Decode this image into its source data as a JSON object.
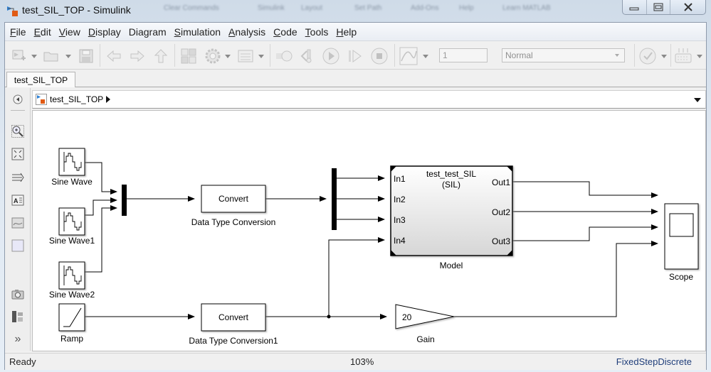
{
  "window": {
    "title": "test_SIL_TOP - Simulink",
    "background_blurred_items": [
      "Clear Commands",
      "Simulink",
      "Layout",
      "Set Path",
      "Add-Ons",
      "Help",
      "Learn MATLAB"
    ],
    "controls": {
      "minimize": "minimize",
      "maximize": "maximize",
      "close": "close"
    }
  },
  "menu": {
    "items": [
      {
        "label": "File",
        "mnemonic": "F",
        "rest": "ile"
      },
      {
        "label": "Edit",
        "mnemonic": "E",
        "rest": "dit"
      },
      {
        "label": "View",
        "mnemonic": "V",
        "rest": "iew"
      },
      {
        "label": "Display",
        "mnemonic": "D",
        "rest": "isplay"
      },
      {
        "label": "Diagram",
        "mnemonic": "",
        "rest": "Diagram"
      },
      {
        "label": "Simulation",
        "mnemonic": "S",
        "rest": "imulation"
      },
      {
        "label": "Analysis",
        "mnemonic": "A",
        "rest": "nalysis"
      },
      {
        "label": "Code",
        "mnemonic": "C",
        "rest": "ode"
      },
      {
        "label": "Tools",
        "mnemonic": "T",
        "rest": "ools"
      },
      {
        "label": "Help",
        "mnemonic": "H",
        "rest": "elp"
      }
    ]
  },
  "toolbar": {
    "stop_time": "1",
    "sim_mode": "Normal",
    "icons": [
      "new-model-icon",
      "open-folder-icon",
      "save-icon",
      "back-icon",
      "forward-icon",
      "up-icon",
      "library-browser-icon",
      "model-config-icon",
      "model-explorer-icon",
      "step-back-icon",
      "breakpoint-icon",
      "run-icon",
      "step-forward-icon",
      "stop-icon",
      "scope-icon",
      "check-icon",
      "build-icon"
    ]
  },
  "tabs": [
    {
      "label": "test_SIL_TOP",
      "active": true
    }
  ],
  "breadcrumb": {
    "model": "test_SIL_TOP"
  },
  "left_toolbar": {
    "icons": [
      "hide-browser-icon",
      "zoom-icon",
      "fit-to-view-icon",
      "route-lines-icon",
      "annotation-icon",
      "image-icon",
      "area-icon",
      "screenshot-icon",
      "model-browser-icon",
      "more-icon"
    ]
  },
  "diagram": {
    "blocks": {
      "sine1": {
        "label": "Sine Wave"
      },
      "sine2": {
        "label": "Sine Wave1"
      },
      "sine3": {
        "label": "Sine Wave2"
      },
      "ramp": {
        "label": "Ramp"
      },
      "dtc1": {
        "text": "Convert",
        "label": "Data Type Conversion"
      },
      "dtc2": {
        "text": "Convert",
        "label": "Data Type Conversion1"
      },
      "model": {
        "title": "test_test_SIL",
        "mode": "(SIL)",
        "label": "Model",
        "inports": [
          "In1",
          "In2",
          "In3",
          "In4"
        ],
        "outports": [
          "Out1",
          "Out2",
          "Out3"
        ]
      },
      "gain": {
        "value": "20",
        "label": "Gain"
      },
      "scope": {
        "label": "Scope"
      }
    }
  },
  "status": {
    "state": "Ready",
    "zoom": "103%",
    "solver": "FixedStepDiscrete"
  }
}
